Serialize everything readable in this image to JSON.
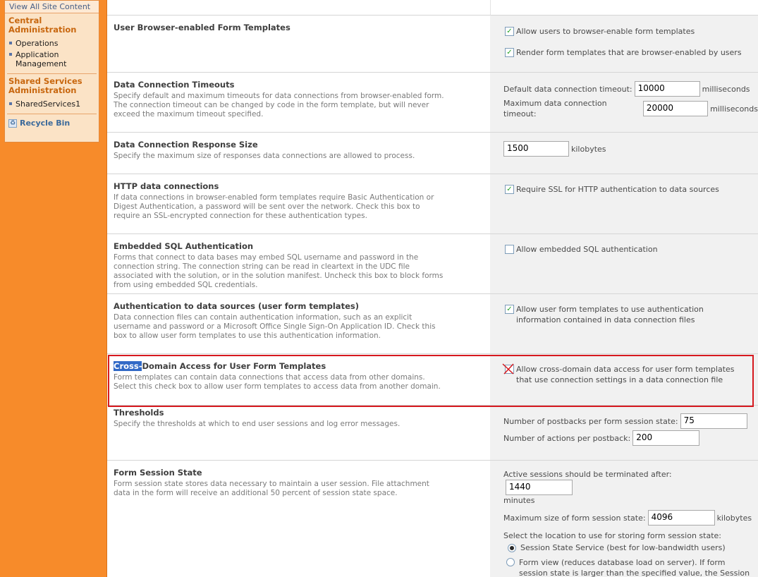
{
  "nav": {
    "view_all": "View All Site Content",
    "central_admin": "Central Administration",
    "central_items": [
      {
        "label": "Operations"
      },
      {
        "label": "Application Management"
      }
    ],
    "shared_services": "Shared Services Administration",
    "shared_items": [
      {
        "label": "SharedServices1"
      }
    ],
    "recycle_bin": "Recycle Bin"
  },
  "sections": {
    "browser_enabled": {
      "title": "User Browser-enabled Form Templates",
      "cb1": "Allow users to browser-enable form templates",
      "cb1_checked": true,
      "cb2": "Render form templates that are browser-enabled by users",
      "cb2_checked": true
    },
    "timeouts": {
      "title": "Data Connection Timeouts",
      "text": "Specify default and maximum timeouts for data connections from browser-enabled form. The connection timeout can be changed by code in the form template, but will never exceed the maximum timeout specified.",
      "default_label": "Default data connection timeout:",
      "default_value": "10000",
      "max_label": "Maximum data connection timeout:",
      "max_value": "20000",
      "unit": "milliseconds"
    },
    "response_size": {
      "title": "Data Connection Response Size",
      "text": "Specify the maximum size of responses data connections are allowed to process.",
      "value": "1500",
      "unit": "kilobytes"
    },
    "http": {
      "title": "HTTP data connections",
      "text": "If data connections in browser-enabled form templates require Basic Authentication or Digest Authentication, a password will be sent over the network. Check this box to require an SSL-encrypted connection for these authentication types.",
      "cb": "Require SSL for HTTP authentication to data sources",
      "cb_checked": true
    },
    "sql": {
      "title": "Embedded SQL Authentication",
      "text": "Forms that connect to data bases may embed SQL username and password in the connection string. The connection string can be read in cleartext in the UDC file associated with the solution, or in the solution manifest. Uncheck this box to block forms from using embedded SQL credentials.",
      "cb": "Allow embedded SQL authentication",
      "cb_checked": false
    },
    "auth": {
      "title": "Authentication to data sources (user form templates)",
      "text": "Data connection files can contain authentication information, such as an explicit username and password or a Microsoft Office Single Sign-On Application ID. Check this box to allow user form templates to use this authentication information.",
      "cb": "Allow user form templates to use authentication information contained in data connection files",
      "cb_checked": true
    },
    "cross_domain": {
      "title_selected": "Cross-",
      "title_rest": "Domain Access for User Form Templates",
      "text": "Form templates can contain data connections that access data from other domains. Select this check box to allow user form templates to access data from another domain.",
      "cb": "Allow cross-domain data access for user form templates that use connection settings in a data connection file",
      "cb_checked": false
    },
    "thresholds": {
      "title": "Thresholds",
      "text": "Specify the thresholds at which to end user sessions and log error messages.",
      "postbacks_label": "Number of postbacks per form session state:",
      "postbacks_value": "75",
      "actions_label": "Number of actions per postback:",
      "actions_value": "200"
    },
    "session": {
      "title": "Form Session State",
      "text": "Form session state stores data necessary to maintain a user session. File attachment data in the form will receive an additional 50 percent of session state space.",
      "active_label": "Active sessions should be terminated after:",
      "active_value": "1440",
      "active_unit": "minutes",
      "maxsize_label": "Maximum size of form session state:",
      "maxsize_value": "4096",
      "maxsize_unit": "kilobytes",
      "location_label": "Select the location to use for storing form session state:",
      "radio1": "Session State Service (best for low-bandwidth users)",
      "radio2": "Form view (reduces database load on server). If form session state is larger than the specified value, the Session State Service will be"
    }
  },
  "colors": {
    "nav_orange": "#f78b2a",
    "annotation_red": "#d6191f",
    "selection_blue": "#3169c6"
  }
}
